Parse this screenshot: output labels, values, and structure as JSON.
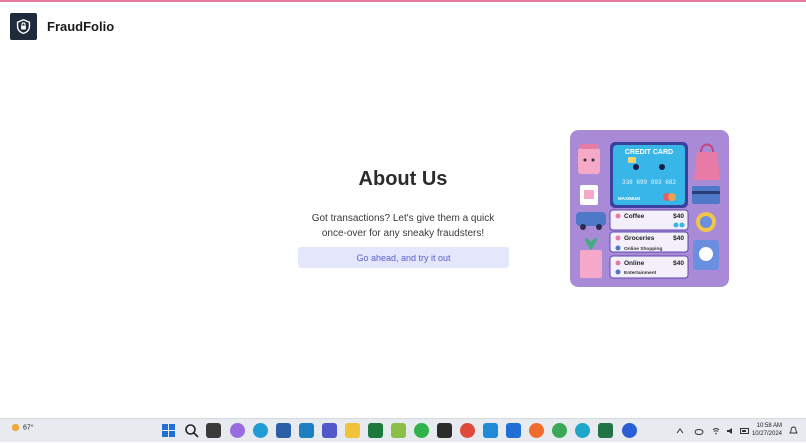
{
  "app": {
    "brand": "FraudFolio",
    "logo_icon": "shield-lock-icon"
  },
  "hero": {
    "title": "About Us",
    "description": "Got transactions? Let's give them a quick once-over for any sneaky fraudsters!",
    "cta_label": "Go ahead, and try it out"
  },
  "illustration": {
    "card_title": "CREDIT CARD",
    "card_number": "338 699 993 682",
    "card_brand": "MAXIMUM",
    "transactions": [
      {
        "label": "Coffee",
        "amount": "$40",
        "sub": ""
      },
      {
        "label": "Groceries",
        "amount": "$40",
        "sub": "Online Shopping"
      },
      {
        "label": "Online",
        "amount": "$40",
        "sub": "Entertainment"
      }
    ]
  },
  "taskbar": {
    "weather": "67°",
    "time": "10:58 AM",
    "date": "10/27/2024",
    "apps": [
      "start-icon",
      "search-icon",
      "task-view-icon",
      "copilot-icon",
      "edge-icon",
      "store-icon",
      "photos-icon",
      "teams-icon",
      "file-explorer-icon",
      "excel-icon",
      "vpn-icon",
      "whatsapp-icon",
      "terminal-icon",
      "chrome-icon",
      "vscode-icon",
      "outlook-icon",
      "postman-icon",
      "chrome-profile-icon",
      "edge-dev-icon",
      "excel-green-icon",
      "blue-circle-app-icon"
    ]
  },
  "colors": {
    "accent": "#5b5fcf",
    "cta_bg": "#e4e7fb",
    "top_line": "#e47a9c",
    "illus_bg": "#a98ad6"
  }
}
